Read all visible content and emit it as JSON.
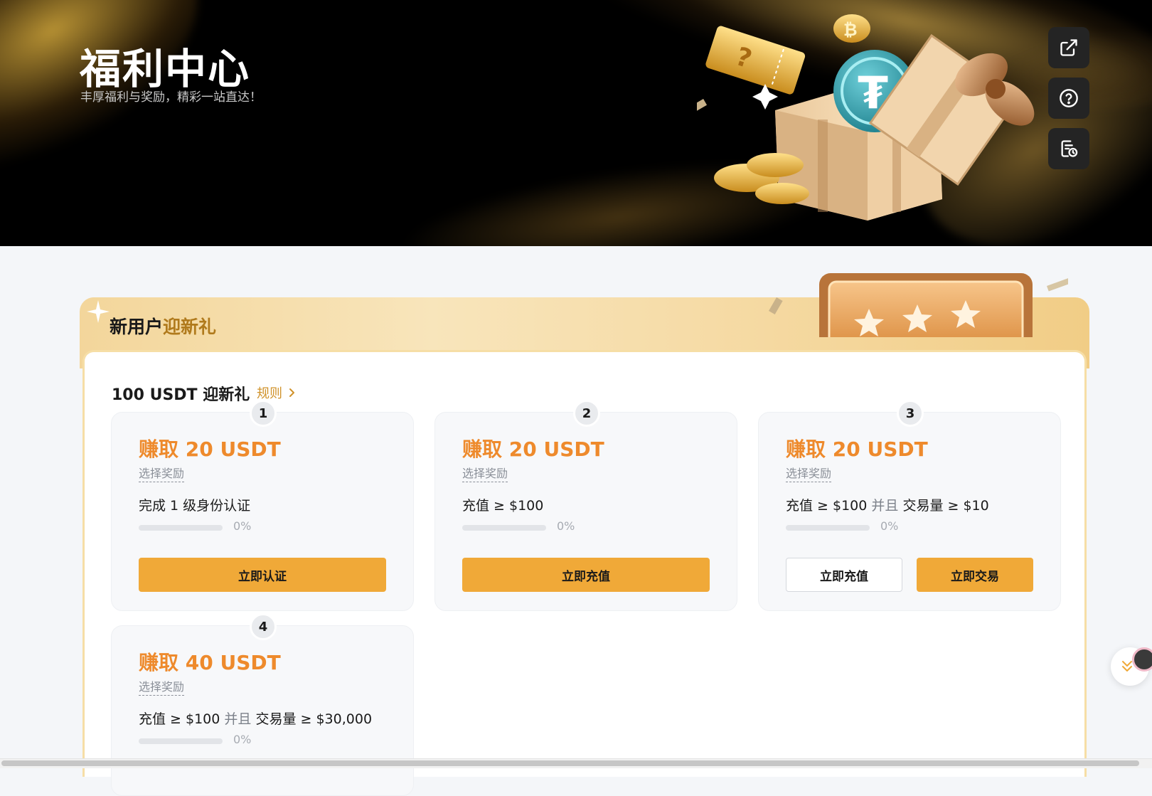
{
  "hero": {
    "title": "福利中心",
    "subtitle": "丰厚福利与奖励，精彩一站直达！"
  },
  "side_actions": [
    {
      "icon": "external-link-icon"
    },
    {
      "icon": "help-circle-icon"
    },
    {
      "icon": "records-icon"
    }
  ],
  "section": {
    "title_main": "新用户",
    "title_accent": "迎新礼",
    "heading": "100 USDT 迎新礼",
    "rules_label": "规则"
  },
  "cards": [
    {
      "number": "1",
      "earn": "赚取 20 USDT",
      "choose": "选择奖励",
      "task": "完成 1 级身份认证",
      "progress": 0,
      "progress_label": "0%",
      "buttons": [
        {
          "label": "立即认证"
        }
      ]
    },
    {
      "number": "2",
      "earn": "赚取 20 USDT",
      "choose": "选择奖励",
      "task": "充值 ≥ $100",
      "progress": 0,
      "progress_label": "0%",
      "buttons": [
        {
          "label": "立即充值"
        }
      ]
    },
    {
      "number": "3",
      "earn": "赚取 20 USDT",
      "choose": "选择奖励",
      "task_part1": "充值 ≥ $100",
      "task_and": "并且",
      "task_part2": "交易量 ≥ $10",
      "progress": 0,
      "progress_label": "0%",
      "buttons": [
        {
          "label": "立即充值"
        },
        {
          "label": "立即交易"
        }
      ]
    },
    {
      "number": "4",
      "earn": "赚取 40 USDT",
      "choose": "选择奖励",
      "task_part1": "充值 ≥ $100",
      "task_and": "并且",
      "task_part2": "交易量 ≥ $30,000",
      "progress": 0,
      "progress_label": "0%"
    }
  ],
  "colors": {
    "accent_orange": "#ee8a2c",
    "button_gold": "#f0a938",
    "hero_bg": "#000000"
  }
}
